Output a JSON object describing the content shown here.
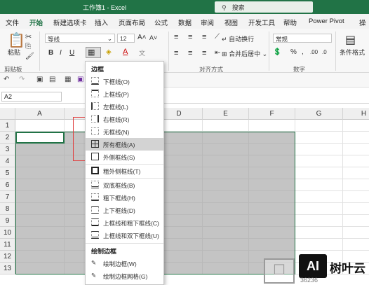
{
  "window": {
    "title": "工作簿1 - Excel",
    "search_placeholder": "搜索"
  },
  "menu": {
    "tabs": [
      "文件",
      "开始",
      "新建选项卡",
      "插入",
      "页面布局",
      "公式",
      "数据",
      "审阅",
      "视图",
      "开发工具",
      "帮助",
      "Power Pivot"
    ],
    "right": "操"
  },
  "ribbon": {
    "paste_label": "粘贴",
    "clipboard_label": "剪贴板",
    "font_name": "等线",
    "font_size": "12",
    "bold": "B",
    "italic": "I",
    "underline": "U",
    "wrap_text": "自动换行",
    "merge_center": "合并后居中",
    "alignment_label": "对齐方式",
    "number_format": "常规",
    "number_label": "数字",
    "conditional_format": "条件格式"
  },
  "formula_bar": {
    "name_box": "A2"
  },
  "grid": {
    "columns": [
      "A",
      "B",
      "C",
      "D",
      "E",
      "F",
      "G",
      "H"
    ],
    "rows": [
      "1",
      "2",
      "3",
      "4",
      "5",
      "6",
      "7",
      "8",
      "9",
      "10",
      "11",
      "12",
      "13"
    ]
  },
  "borders_menu": {
    "header": "边框",
    "items": [
      "下框线(O)",
      "上框线(P)",
      "左框线(L)",
      "右框线(R)",
      "无框线(N)",
      "所有框线(A)",
      "外侧框线(S)",
      "粗外侧框线(T)",
      "双底框线(B)",
      "粗下框线(H)",
      "上下框线(D)",
      "上框线和粗下框线(C)",
      "上框线和双下框线(U)"
    ],
    "draw_header": "绘制边框",
    "draw_items": [
      "绘制边框(W)",
      "绘制边框网格(G)"
    ]
  },
  "watermark": {
    "logo_text": "AI",
    "name": "树叶云",
    "number": "36236"
  }
}
